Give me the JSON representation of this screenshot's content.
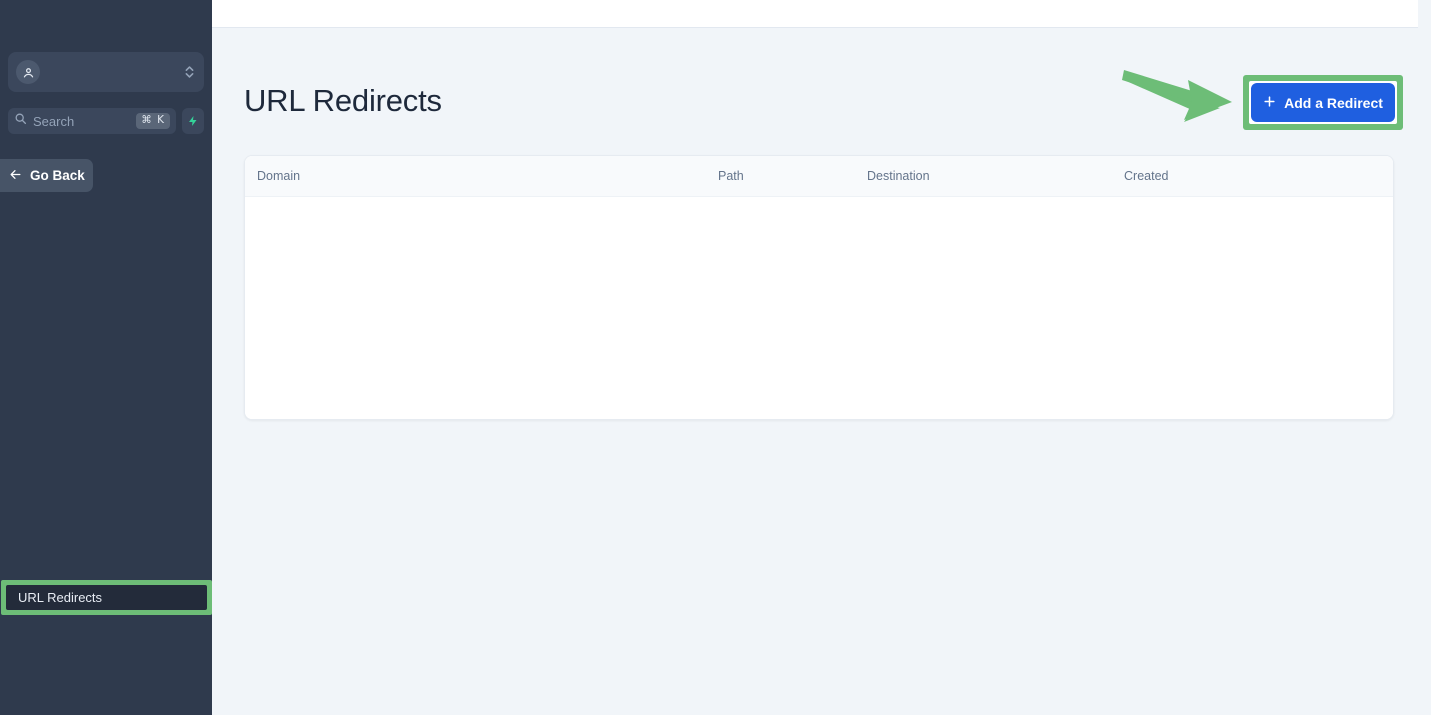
{
  "theme": {
    "sidebar_bg": "#2f3a4d",
    "accent_blue": "#1f5fe0",
    "highlight_green": "#6dbd77",
    "page_bg": "#f1f5f9",
    "bolt_green": "#34d399"
  },
  "sidebar": {
    "org_switcher": {
      "avatar_icon": "user-pin-icon",
      "name": "",
      "chevron_icon": "chevron-up-down-icon"
    },
    "search": {
      "icon": "search-icon",
      "placeholder": "Search",
      "shortcut": "⌘ K",
      "bolt_icon": "lightning-bolt-icon"
    },
    "go_back": {
      "label": "Go Back",
      "icon": "arrow-left-icon"
    },
    "active_item": {
      "label": "URL Redirects"
    }
  },
  "main": {
    "page_title": "URL Redirects",
    "add_button": {
      "label": "Add a Redirect",
      "icon": "plus-icon"
    },
    "table": {
      "columns": [
        "Domain",
        "Path",
        "Destination",
        "Created"
      ],
      "rows": []
    }
  },
  "annotations": {
    "arrow": "green-arrow-pointing-right",
    "highlight_boxes": [
      "add-a-redirect-button",
      "url-redirects-nav-item"
    ]
  }
}
